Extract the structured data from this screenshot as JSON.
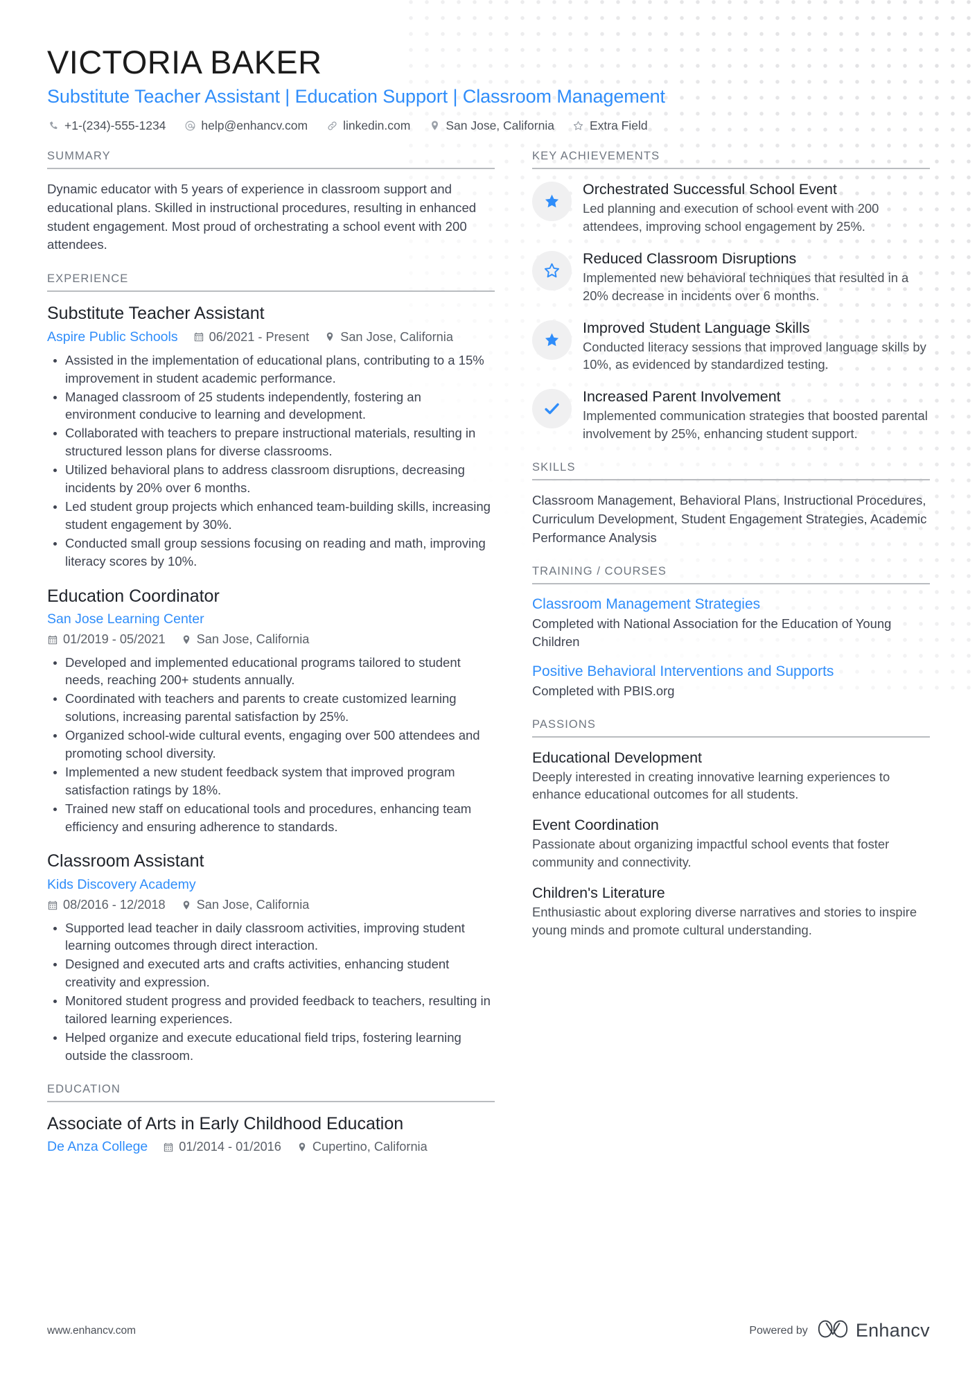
{
  "header": {
    "full_name": "VICTORIA BAKER",
    "headline": "Substitute Teacher Assistant | Education Support | Classroom Management",
    "contacts": [
      {
        "icon": "phone-icon",
        "text": "+1-(234)-555-1234"
      },
      {
        "icon": "email-icon",
        "text": "help@enhancv.com"
      },
      {
        "icon": "link-icon",
        "text": "linkedin.com"
      },
      {
        "icon": "location-icon",
        "text": "San Jose, California"
      },
      {
        "icon": "star-outline-icon",
        "text": "Extra Field"
      }
    ]
  },
  "summary": {
    "title": "SUMMARY",
    "text": "Dynamic educator with 5 years of experience in classroom support and educational plans. Skilled in instructional procedures, resulting in enhanced student engagement. Most proud of orchestrating a school event with 200 attendees."
  },
  "experience": {
    "title": "EXPERIENCE",
    "entries": [
      {
        "role": "Substitute Teacher Assistant",
        "org": "Aspire Public Schools",
        "dates": "06/2021 - Present",
        "location": "San Jose, California",
        "layout": "inline",
        "bullets": [
          "Assisted in the implementation of educational plans, contributing to a 15% improvement in student academic performance.",
          "Managed classroom of 25 students independently, fostering an environment conducive to learning and development.",
          "Collaborated with teachers to prepare instructional materials, resulting in structured lesson plans for diverse classrooms.",
          "Utilized behavioral plans to address classroom disruptions, decreasing incidents by 20% over 6 months.",
          "Led student group projects which enhanced team-building skills, increasing student engagement by 30%.",
          "Conducted small group sessions focusing on reading and math, improving literacy scores by 10%."
        ]
      },
      {
        "role": "Education Coordinator",
        "org": "San Jose Learning Center",
        "dates": "01/2019 - 05/2021",
        "location": "San Jose, California",
        "layout": "stacked",
        "bullets": [
          "Developed and implemented educational programs tailored to student needs, reaching 200+ students annually.",
          "Coordinated with teachers and parents to create customized learning solutions, increasing parental satisfaction by 25%.",
          "Organized school-wide cultural events, engaging over 500 attendees and promoting school diversity.",
          "Implemented a new student feedback system that improved program satisfaction ratings by 18%.",
          "Trained new staff on educational tools and procedures, enhancing team efficiency and ensuring adherence to standards."
        ]
      },
      {
        "role": "Classroom Assistant",
        "org": "Kids Discovery Academy",
        "dates": "08/2016 - 12/2018",
        "location": "San Jose, California",
        "layout": "stacked",
        "bullets": [
          "Supported lead teacher in daily classroom activities, improving student learning outcomes through direct interaction.",
          "Designed and executed arts and crafts activities, enhancing student creativity and expression.",
          "Monitored student progress and provided feedback to teachers, resulting in tailored learning experiences.",
          "Helped organize and execute educational field trips, fostering learning outside the classroom."
        ]
      }
    ]
  },
  "education": {
    "title": "EDUCATION",
    "entries": [
      {
        "degree": "Associate of Arts in Early Childhood Education",
        "org": "De Anza College",
        "dates": "01/2014 - 01/2016",
        "location": "Cupertino, California"
      }
    ]
  },
  "key_achievements": {
    "title": "KEY ACHIEVEMENTS",
    "items": [
      {
        "icon": "star-filled-icon",
        "title": "Orchestrated Successful School Event",
        "desc": "Led planning and execution of school event with 200 attendees, improving school engagement by 25%."
      },
      {
        "icon": "star-outline-icon",
        "title": "Reduced Classroom Disruptions",
        "desc": "Implemented new behavioral techniques that resulted in a 20% decrease in incidents over 6 months."
      },
      {
        "icon": "star-filled-icon",
        "title": "Improved Student Language Skills",
        "desc": "Conducted literacy sessions that improved language skills by 10%, as evidenced by standardized testing."
      },
      {
        "icon": "check-icon",
        "title": "Increased Parent Involvement",
        "desc": "Implemented communication strategies that boosted parental involvement by 25%, enhancing student support."
      }
    ]
  },
  "skills": {
    "title": "SKILLS",
    "text": "Classroom Management, Behavioral Plans, Instructional Procedures, Curriculum Development, Student Engagement Strategies, Academic Performance Analysis"
  },
  "training": {
    "title": "TRAINING / COURSES",
    "items": [
      {
        "name": "Classroom Management Strategies",
        "desc": "Completed with National Association for the Education of Young Children"
      },
      {
        "name": "Positive Behavioral Interventions and Supports",
        "desc": "Completed with PBIS.org"
      }
    ]
  },
  "passions": {
    "title": "PASSIONS",
    "items": [
      {
        "name": "Educational Development",
        "desc": "Deeply interested in creating innovative learning experiences to enhance educational outcomes for all students."
      },
      {
        "name": "Event Coordination",
        "desc": "Passionate about organizing impactful school events that foster community and connectivity."
      },
      {
        "name": "Children's Literature",
        "desc": "Enthusiastic about exploring diverse narratives and stories to inspire young minds and promote cultural understanding."
      }
    ]
  },
  "footer": {
    "url": "www.enhancv.com",
    "powered_by": "Powered by",
    "brand": "Enhancv"
  },
  "colors": {
    "accent": "#2f8dfa",
    "text": "#3f4451",
    "muted": "#6f7680",
    "rule": "#b9bcc0",
    "badge_bg": "#f0f0f1"
  }
}
